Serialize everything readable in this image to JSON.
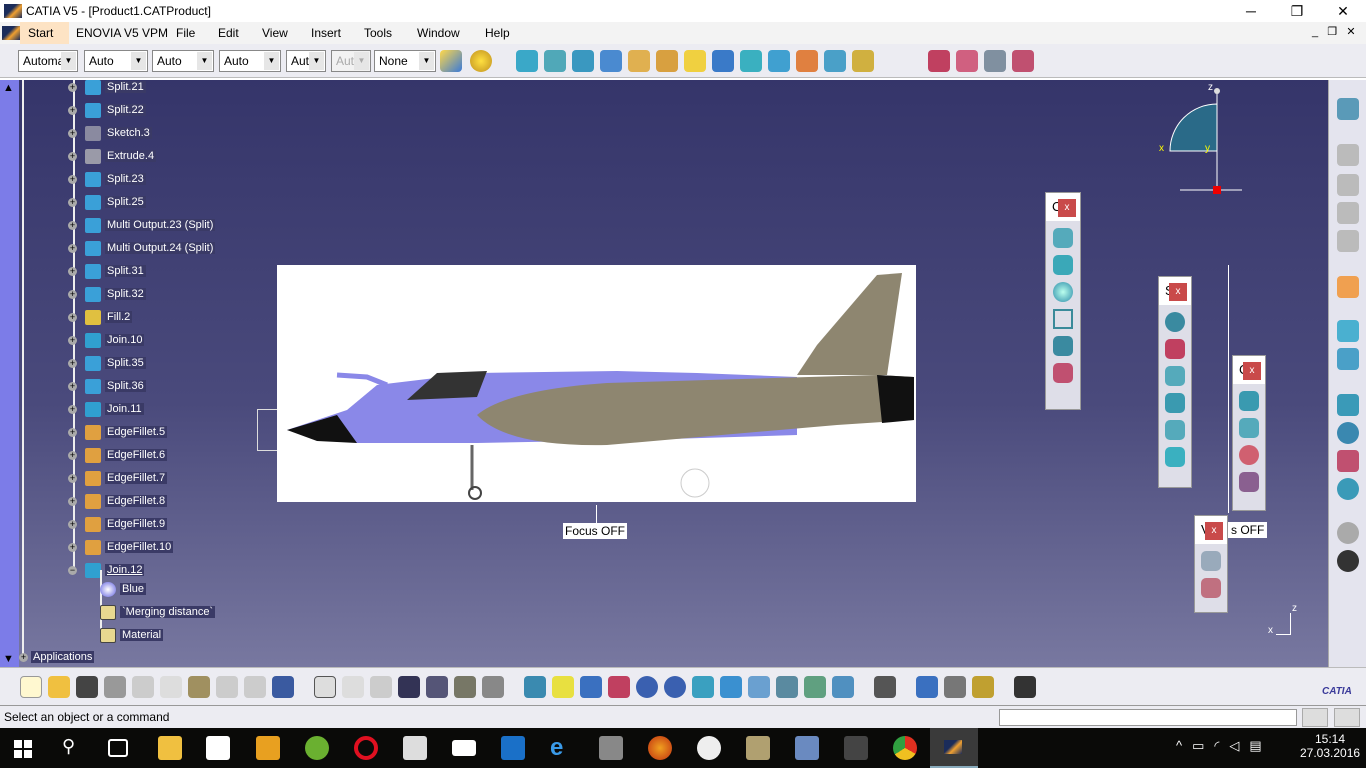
{
  "window": {
    "title": "CATIA V5 - [Product1.CATProduct]",
    "minimize": "─",
    "restore": "❐",
    "close": "✕"
  },
  "menu": {
    "items": [
      "Start",
      "ENOVIA V5 VPM",
      "File",
      "Edit",
      "View",
      "Insert",
      "Tools",
      "Window",
      "Help"
    ]
  },
  "toolbar": {
    "combos": [
      "Automa",
      "Auto",
      "Auto",
      "Auto",
      "Aut",
      "Aut",
      "None"
    ]
  },
  "tree": {
    "items": [
      {
        "label": "Split.21",
        "color": "#3aa0d8"
      },
      {
        "label": "Split.22",
        "color": "#3aa0d8"
      },
      {
        "label": "Sketch.3",
        "color": "#8a8aa0"
      },
      {
        "label": "Extrude.4",
        "color": "#9a9aa8"
      },
      {
        "label": "Split.23",
        "color": "#3aa0d8"
      },
      {
        "label": "Split.25",
        "color": "#3aa0d8"
      },
      {
        "label": "Multi Output.23 (Split)",
        "color": "#3aa0d8"
      },
      {
        "label": "Multi Output.24 (Split)",
        "color": "#3aa0d8"
      },
      {
        "label": "Split.31",
        "color": "#3aa0d8"
      },
      {
        "label": "Split.32",
        "color": "#3aa0d8"
      },
      {
        "label": "Fill.2",
        "color": "#e0c040"
      },
      {
        "label": "Join.10",
        "color": "#30a0d0"
      },
      {
        "label": "Split.35",
        "color": "#3aa0d8"
      },
      {
        "label": "Split.36",
        "color": "#3aa0d8"
      },
      {
        "label": "Join.11",
        "color": "#30a0d0"
      },
      {
        "label": "EdgeFillet.5",
        "color": "#e0a040"
      },
      {
        "label": "EdgeFillet.6",
        "color": "#e0a040"
      },
      {
        "label": "EdgeFillet.7",
        "color": "#e0a040"
      },
      {
        "label": "EdgeFillet.8",
        "color": "#e0a040"
      },
      {
        "label": "EdgeFillet.9",
        "color": "#e0a040"
      },
      {
        "label": "EdgeFillet.10",
        "color": "#e0a040"
      },
      {
        "label": "Join.12",
        "color": "#30a0d0"
      }
    ],
    "children": [
      {
        "label": "Blue"
      },
      {
        "label": "`Merging distance`"
      },
      {
        "label": "Material"
      }
    ],
    "root": "Applications"
  },
  "viewport": {
    "focus": "Focus OFF",
    "vis_partial": "s OFF",
    "vis_prefix": "V",
    "compass": {
      "x": "x",
      "y": "y",
      "z": "z"
    },
    "axis": {
      "x": "x",
      "z": "z"
    }
  },
  "floating_toolbars": [
    {
      "title": "C",
      "close": "x"
    },
    {
      "title": "S",
      "close": "x"
    },
    {
      "title": "C",
      "close": "x"
    },
    {
      "title": "V",
      "close": "x"
    }
  ],
  "status": {
    "message": "Select an object or a command"
  },
  "brand": "CATIA",
  "clock": {
    "time": "15:14",
    "date": "27.03.2016"
  }
}
